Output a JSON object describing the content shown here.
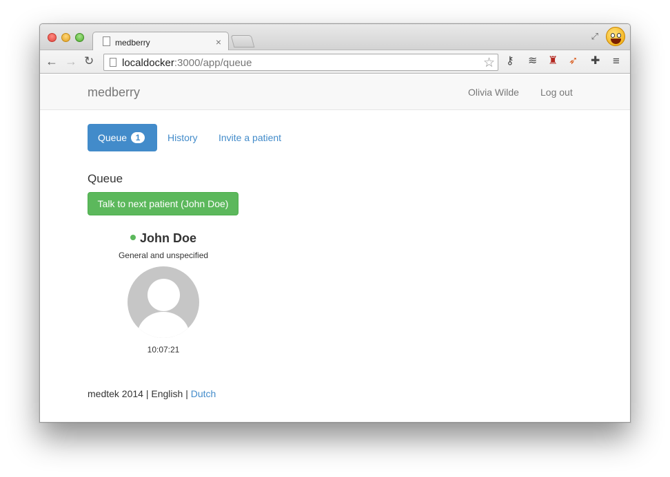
{
  "browser": {
    "tab_title": "medberry",
    "tab_close": "×",
    "url_host": "localdocker",
    "url_rest": ":3000/app/queue"
  },
  "navbar": {
    "brand": "medberry",
    "user": "Olivia Wilde",
    "logout": "Log out"
  },
  "tabs": [
    {
      "label": "Queue",
      "badge": "1",
      "active": true
    },
    {
      "label": "History",
      "active": false
    },
    {
      "label": "Invite a patient",
      "active": false
    }
  ],
  "queue": {
    "title": "Queue",
    "next_button": "Talk to next patient (John Doe)",
    "patient": {
      "name": "John Doe",
      "category": "General and unspecified",
      "time": "10:07:21",
      "status_color": "#5cb85c"
    }
  },
  "footer": {
    "company": "medtek 2014",
    "sep1": "|",
    "lang_current": "English",
    "sep2": "|",
    "lang_other": "Dutch"
  },
  "colors": {
    "primary": "#428bca",
    "success": "#5cb85c"
  },
  "icons": [
    "page-icon",
    "star-icon",
    "key-icon",
    "layers-icon",
    "sofa-icon",
    "rocket-icon",
    "puzzle-icon",
    "menu-icon"
  ]
}
